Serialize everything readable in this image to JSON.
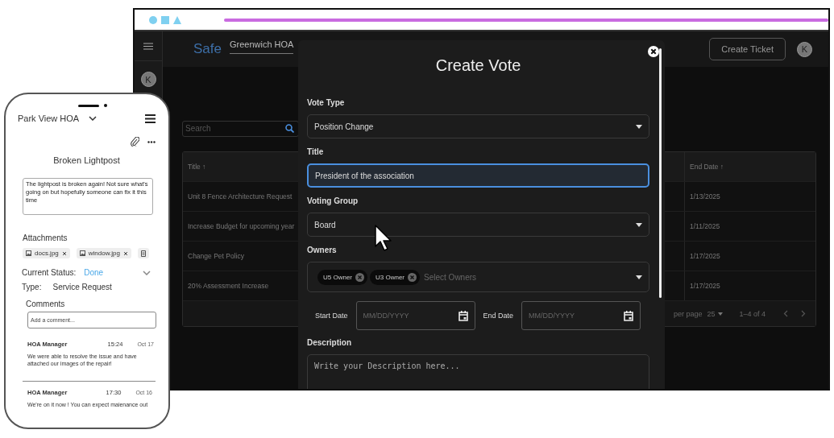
{
  "app": {
    "brand": "Safe",
    "hoa": "Greenwich HOA",
    "create_button": "Create Ticket",
    "avatar": "K",
    "sidebar_avatar": "K",
    "search": {
      "placeholder": "Search"
    },
    "table": {
      "columns": [
        "Title ↑",
        "End Date ↑"
      ],
      "rows": [
        {
          "title": "Unit 8 Fence Architecture Request",
          "end_date": "1/13/2025"
        },
        {
          "title": "Increase Budget for upcoming year",
          "end_date": "1/11/2025"
        },
        {
          "title": "Change Pet Policy",
          "end_date": "1/17/2025"
        },
        {
          "title": "20% Assessment Increase",
          "end_date": "1/17/2025"
        }
      ],
      "pagination": {
        "rows_label": "per page",
        "page_size": "25",
        "range": "1–4 of 4"
      }
    }
  },
  "modal": {
    "title": "Create Vote",
    "fields": [
      {
        "kind": "select",
        "label": "Vote Type",
        "value": "Position Change",
        "focused": false
      },
      {
        "kind": "text",
        "label": "Title",
        "value": "President of the association",
        "focused": true
      },
      {
        "kind": "select",
        "label": "Voting Group",
        "value": "Board",
        "focused": false
      },
      {
        "kind": "multiselect",
        "label": "Owners",
        "chips": [
          "U5 Owner",
          "U3 Owner"
        ],
        "placeholder": "Select Owners",
        "focused": false
      },
      {
        "kind": "daterange",
        "start_label": "Start Date",
        "start_placeholder": "MM/DD/YYYY",
        "end_label": "End Date",
        "end_placeholder": "MM/DD/YYYY",
        "focused": false
      },
      {
        "kind": "textarea",
        "label": "Description",
        "placeholder": "Write your Description here...",
        "focused": false
      }
    ]
  },
  "phone": {
    "hoa": "Park View HOA",
    "title": "Broken Lightpost",
    "description": "The lightpost is broken again! Not sure what's going on but hopefully someone can fix it this time",
    "attachments_label": "Attachments",
    "attachments": [
      "docs.jpg",
      "window.jpg"
    ],
    "status_label": "Current Status:",
    "status": "Done",
    "type_label": "Type:",
    "type": "Service Request",
    "comments_label": "Comments",
    "comment_placeholder": "Add a comment...",
    "comments": [
      {
        "author": "HOA Manager",
        "time": "15:24",
        "date": "Oct 17",
        "text": "We were able to resolve the issue and have attached our images of the repair!"
      },
      {
        "author": "HOA Manager",
        "time": "17:30",
        "date": "Oct 16",
        "text": "We're on it now ! You can expect maienance out"
      }
    ]
  }
}
